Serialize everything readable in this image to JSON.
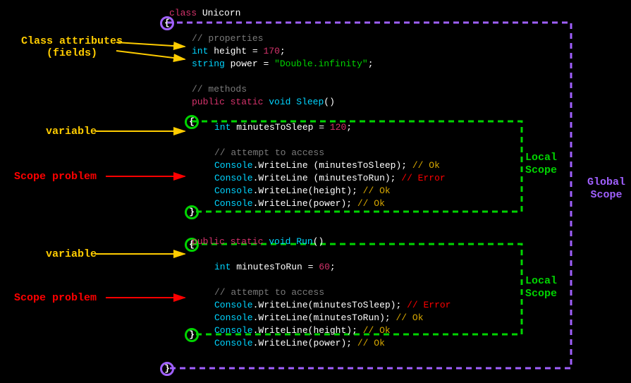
{
  "annotations": {
    "class_attr": "Class attributes\n(fields)",
    "variable1": "variable",
    "scope_problem1": "Scope problem",
    "variable2": "variable",
    "scope_problem2": "Scope problem"
  },
  "global_scope_label": "Global\nScope",
  "local_scope_label1": "Local\nScope",
  "local_scope_label2": "Local\nScope",
  "code": {
    "class_kw": "class",
    "class_name": "Unicorn",
    "prop_comment": "// properties",
    "int_kw": "int",
    "string_kw": "string",
    "height_name": "height",
    "height_val": "170",
    "power_name": "power",
    "power_val": "\"Double.infinity\"",
    "methods_comment": "// methods",
    "public_kw": "public",
    "static_kw": "static",
    "void_kw": "void",
    "sleep_name": "Sleep",
    "run_name": "Run",
    "mts_name": "minutesToSleep",
    "mts_val": "120",
    "mtr_name": "minutesToRun",
    "mtr_val": "60",
    "attempt_comment": "// attempt to access",
    "console": "Console",
    "writeline": "WriteLine",
    "ok": "// Ok",
    "err": "// Error"
  }
}
